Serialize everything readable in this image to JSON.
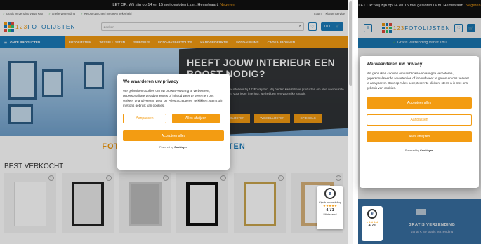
{
  "desktop": {
    "announcement": {
      "text": "LET OP: Wij zijn op 14 en 15 mei gesloten i.v.m. Hemelvaart.",
      "link": "Negeren"
    },
    "usps": [
      "Gratis verzending vanaf €80",
      "Snelle verzending",
      "Retour optioneel met 99% zekerheid"
    ],
    "top_links": [
      "Login",
      "Klantenservice"
    ],
    "logo": {
      "prefix": "123",
      "name": "FOTOLIJSTEN"
    },
    "search": {
      "placeholder": "Zoeken"
    },
    "cart": {
      "amount": "0,00"
    },
    "nav": {
      "all_products": "ONZE PRODUCTEN",
      "items": [
        "FOTOLIJSTEN",
        "WISSELLIJSTEN",
        "SPIEGELS",
        "FOTO-PASPARTOUTS",
        "HANDGEDRUKTE",
        "FOTOALBUMS",
        "CADEAUBONNEN"
      ]
    },
    "hero": {
      "title": "HEEFT JOUW INTERIEUR EEN BOOST NODIG?",
      "subtitle": "Verfraai jouw interieur bij 123Fotolijsten. Wij bieden kwalitatieve producten om elke woonruimte op te fleuren. Voor ieder interieur, we hebben een voor elke smaak.",
      "buttons": [
        "FOTOLIJSTEN",
        "WISSELLIJSTEN",
        "SPIEGELS"
      ]
    },
    "brand_line": "FOTOLIJSTEN",
    "brand_line2": "123FOTOLIJSTEN",
    "best_sold": "BEST VERKOCHT",
    "trust": {
      "label": "Kiyoh beoordeling",
      "score": "4,71",
      "rating": "Uitstekend",
      "stars": "★★★★★"
    }
  },
  "cookie_desktop": {
    "title": "We waarderen uw privacy",
    "body": "We gebruiken cookies om uw browse-ervaring te verbeteren, gepersonaliseerde advertenties of inhoud weer te geven en ons verkeer te analyseren. Door op 'Alles accepteren' te klikken, stemt u in met ons gebruik van cookies.",
    "customize": "Aanpassen",
    "reject": "Alles afwijzen",
    "accept": "Accepteer alles",
    "powered_prefix": "Powered by",
    "powered_brand": "Cookieyes"
  },
  "mobile": {
    "announcement": {
      "text": "LET OP: Wij zijn op 14 en 15 mei gesloten i.v.m. Hemelvaart.",
      "link": "Negeren"
    },
    "logo": {
      "prefix": "123",
      "name": "FOTOLIJSTEN"
    },
    "shipping_bar": "Gratis verzending vanaf €80",
    "free_shipping": "GRATIS VERZENDING",
    "free_shipping_sub": "Vanaf € 80 gratis verzending",
    "trust": {
      "score": "4,71",
      "stars": "★★★★★"
    }
  },
  "cookie_mobile": {
    "title": "We waarderen uw privacy",
    "body": "We gebruiken cookies om uw browse-ervaring te verbeteren, gepersonaliseerde advertenties of inhoud weer te geven en ons verkeer te analyseren. Door op 'Alles accepteren' te klikken, stemt u in met ons gebruik van cookies.",
    "accept": "Accepteer alles",
    "customize": "Aanpassen",
    "reject": "Alles afwijzen",
    "powered_prefix": "Powered by",
    "powered_brand": "Cookieyes"
  },
  "colors": {
    "accent": "#f39c12",
    "brand": "#1a7bb9",
    "dark": "#111111"
  }
}
